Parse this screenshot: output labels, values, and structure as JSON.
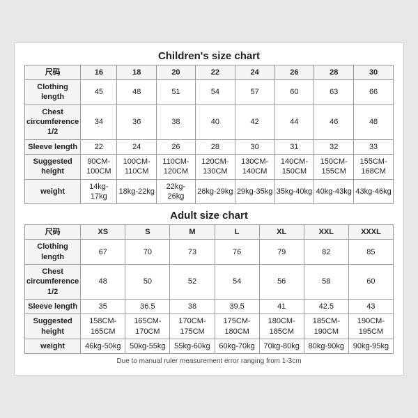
{
  "children_title": "Children's size chart",
  "adult_title": "Adult size chart",
  "note": "Due to manual ruler measurement error ranging from 1-3cm",
  "children": {
    "header": [
      "尺码",
      "16",
      "18",
      "20",
      "22",
      "24",
      "26",
      "28",
      "30"
    ],
    "rows": [
      {
        "label": "Clothing length",
        "values": [
          "45",
          "48",
          "51",
          "54",
          "57",
          "60",
          "63",
          "66"
        ]
      },
      {
        "label": "Chest circumference 1/2",
        "values": [
          "34",
          "36",
          "38",
          "40",
          "42",
          "44",
          "46",
          "48"
        ]
      },
      {
        "label": "Sleeve length",
        "values": [
          "22",
          "24",
          "26",
          "28",
          "30",
          "31",
          "32",
          "33"
        ]
      },
      {
        "label": "Suggested height",
        "values": [
          "90CM-100CM",
          "100CM-110CM",
          "110CM-120CM",
          "120CM-130CM",
          "130CM-140CM",
          "140CM-150CM",
          "150CM-155CM",
          "155CM-168CM"
        ]
      },
      {
        "label": "weight",
        "values": [
          "14kg-17kg",
          "18kg-22kg",
          "22kg-26kg",
          "26kg-29kg",
          "29kg-35kg",
          "35kg-40kg",
          "40kg-43kg",
          "43kg-46kg"
        ]
      }
    ]
  },
  "adult": {
    "header": [
      "尺码",
      "XS",
      "S",
      "M",
      "L",
      "XL",
      "XXL",
      "XXXL"
    ],
    "rows": [
      {
        "label": "Clothing length",
        "values": [
          "67",
          "70",
          "73",
          "76",
          "79",
          "82",
          "85"
        ]
      },
      {
        "label": "Chest circumference 1/2",
        "values": [
          "48",
          "50",
          "52",
          "54",
          "56",
          "58",
          "60"
        ]
      },
      {
        "label": "Sleeve length",
        "values": [
          "35",
          "36.5",
          "38",
          "39.5",
          "41",
          "42.5",
          "43"
        ]
      },
      {
        "label": "Suggested height",
        "values": [
          "158CM-165CM",
          "165CM-170CM",
          "170CM-175CM",
          "175CM-180CM",
          "180CM-185CM",
          "185CM-190CM",
          "190CM-195CM"
        ]
      },
      {
        "label": "weight",
        "values": [
          "46kg-50kg",
          "50kg-55kg",
          "55kg-60kg",
          "60kg-70kg",
          "70kg-80kg",
          "80kg-90kg",
          "90kg-95kg"
        ]
      }
    ]
  }
}
